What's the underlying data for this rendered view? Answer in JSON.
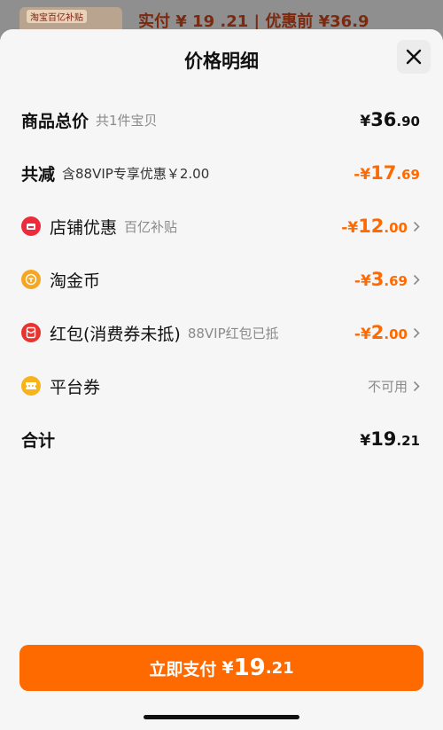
{
  "backdrop": {
    "thumb_tag": "淘宝百亿补贴",
    "price_text": "实付 ¥ 19 .21 | 优惠前 ¥36.9"
  },
  "sheet": {
    "title": "价格明细"
  },
  "rows": {
    "total": {
      "label": "商品总价",
      "sub": "共1件宝贝",
      "yen": "¥",
      "int": "36",
      "dec": ".90"
    },
    "reduction": {
      "label": "共减",
      "sub": "含88VIP专享优惠￥2.00",
      "sign": "-¥",
      "int": "17",
      "dec": ".69"
    },
    "shop": {
      "label": "店铺优惠",
      "sub": "百亿补贴",
      "sign": "-¥",
      "int": "12",
      "dec": ".00"
    },
    "coin": {
      "label": "淘金币",
      "sign": "-¥",
      "int": "3",
      "dec": ".69"
    },
    "redpacket": {
      "label": "红包(消费券未抵)",
      "sub": "88VIP红包已抵",
      "sign": "-¥",
      "int": "2",
      "dec": ".00"
    },
    "platform": {
      "label": "平台券",
      "status": "不可用"
    },
    "sum": {
      "label": "合计",
      "yen": "¥",
      "int": "19",
      "dec": ".21"
    }
  },
  "pay_button": {
    "label": "立即支付",
    "yen": "¥",
    "int": "19",
    "dec": ".21"
  },
  "colors": {
    "accent": "#ff6a00",
    "shop_icon": "#ee2b3b",
    "coin_icon": "#f5a623",
    "redpacket_icon": "#e8332e",
    "platform_icon": "#f7b31a"
  },
  "icons": {
    "close": "close-icon",
    "chevron": "chevron-right-icon",
    "shop": "shop-icon",
    "coin": "coin-icon",
    "redpacket": "red-packet-icon",
    "platform": "coupon-icon"
  }
}
